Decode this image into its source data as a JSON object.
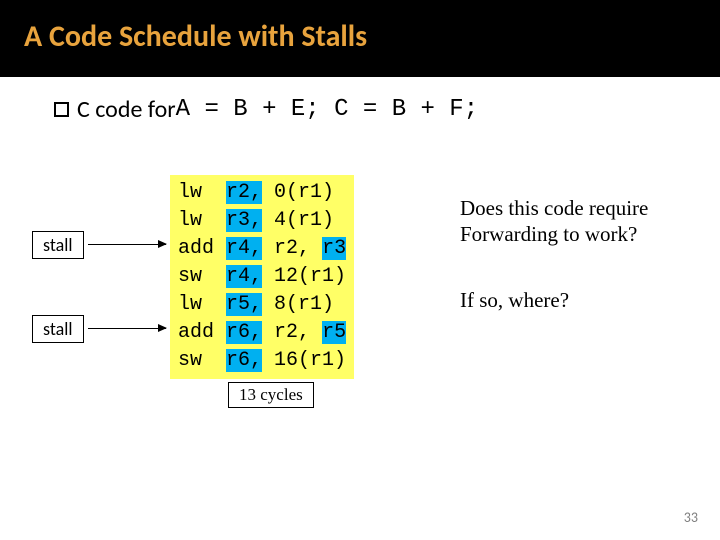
{
  "title": "A Code Schedule with Stalls",
  "bullet_prefix": "C code for ",
  "bullet_expr": "A = B + E; C = B + F;",
  "stall_labels": {
    "s1": "stall",
    "s2": "stall"
  },
  "code_lines": [
    {
      "op": "lw ",
      "rd": "r2,",
      "rs": " 0(r1)",
      "hl": false
    },
    {
      "op": "lw ",
      "rd": "r3,",
      "rs": " 4(r1)",
      "hl": false
    },
    {
      "op": "add",
      "rd": "r4,",
      "rs": " r2, ",
      "hl_reg": "r3"
    },
    {
      "op": "sw ",
      "rd": "r4,",
      "rs": " 12(r1)",
      "hl": false
    },
    {
      "op": "lw ",
      "rd": "r5,",
      "rs": " 8(r1)",
      "hl": false
    },
    {
      "op": "add",
      "rd": "r6,",
      "rs": " r2, ",
      "hl_reg": "r5"
    },
    {
      "op": "sw ",
      "rd": "r6,",
      "rs": " 16(r1)",
      "hl": false
    }
  ],
  "cycles": "13 cycles",
  "note1_l1": "Does this code require",
  "note1_l2": "Forwarding to work?",
  "note2": "If so, where?",
  "page": "33"
}
